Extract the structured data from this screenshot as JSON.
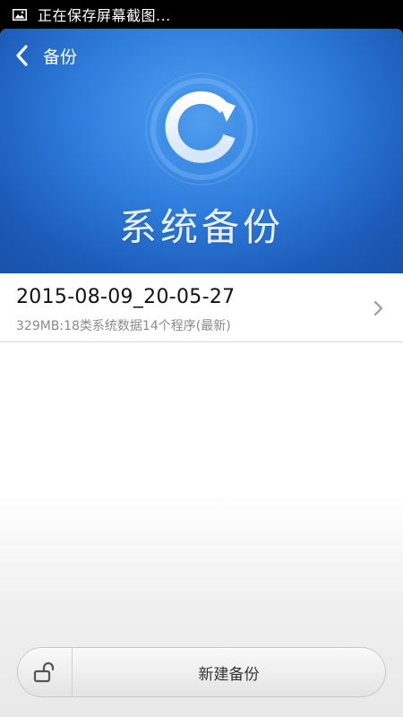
{
  "status_bar": {
    "text": "正在保存屏幕截图..."
  },
  "header": {
    "back_label": "备份",
    "title": "系统备份"
  },
  "backups": [
    {
      "name": "2015-08-09_20-05-27",
      "detail": "329MB:18类系统数据14个程序(最新)"
    }
  ],
  "bottom_bar": {
    "new_backup_label": "新建备份"
  },
  "colors": {
    "header_blue": "#2f7edd",
    "header_dark": "#184fa6",
    "title_text": "#e8f0fb",
    "subtitle_gray": "#8a8a8a"
  }
}
